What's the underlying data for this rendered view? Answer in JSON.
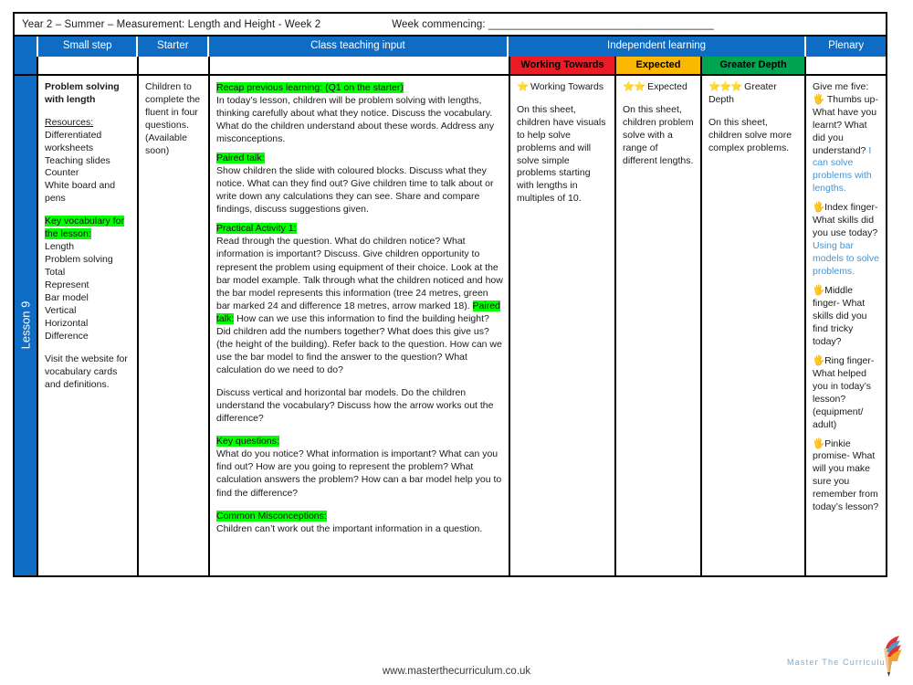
{
  "document": {
    "title_main": "Year 2 – Summer – Measurement: Length and Height  - Week 2",
    "title_week_commencing": "Week commencing: ______________________________________",
    "lesson_spine": "Lesson 9"
  },
  "header": {
    "groups": [
      {
        "label": "Small step"
      },
      {
        "label": "Starter"
      },
      {
        "label": "Class teaching input"
      },
      {
        "label": "Independent learning"
      },
      {
        "label": "Plenary"
      }
    ],
    "independent_sub": [
      {
        "label": "Working Towards",
        "color": "#ec1c24"
      },
      {
        "label": "Expected",
        "color": "#fbb800"
      },
      {
        "label": "Greater Depth",
        "color": "#00a551"
      }
    ]
  },
  "small_step": {
    "heading": "Problem solving with length",
    "resources_label": "Resources:",
    "resources": [
      "Differentiated worksheets",
      "Teaching slides",
      "Counter",
      "White board and pens"
    ],
    "vocab_label": "Key vocabulary for the lesson:",
    "vocab": [
      "Length",
      "Problem solving",
      "Total",
      "Represent",
      "Bar model",
      "Vertical",
      "Horizontal",
      "Difference"
    ],
    "footnote": "Visit the website for vocabulary cards and definitions."
  },
  "starter": {
    "text": "Children to complete the fluent in four questions. (Available soon)"
  },
  "class_teaching_input": {
    "recap_label": "Recap previous learning: (Q1 on the starter)",
    "recap_text": "In today’s lesson, children will be problem solving with lengths, thinking carefully about what they notice. Discuss the vocabulary. What do the children understand about these words. Address any misconceptions.",
    "paired_talk_label": "Paired talk:",
    "paired_talk_text": "Show children the slide with coloured blocks. Discuss what they notice. What can they find out? Give children time to talk about or write down any calculations they can see. Share and compare findings, discuss suggestions given.",
    "practical_label": "Practical Activity 1:",
    "practical_text_part1": "Read through the question. What do children notice? What information is important? Discuss. Give children opportunity to represent the problem using equipment of their choice. Look at the bar model example. Talk through what the children noticed and how the bar model represents this information (tree 24 metres, green bar marked 24 and difference 18 metres, arrow marked 18). ",
    "practical_inline_label": "Paired talk:",
    "practical_text_part2": " How can we use this information to find the building height? Did children add the numbers together? What does this give us? (the height of the building). Refer back to the question. How can we use the bar model to find the answer to the question? What calculation do we need to do?",
    "discuss_text": "Discuss vertical and horizontal bar models. Do the children understand the vocabulary? Discuss how the arrow works out the difference?",
    "key_questions_label": "Key questions:",
    "key_questions_text": "What do you notice? What information is important? What can you find out? How are you going to represent the problem? What calculation answers the problem? How can a bar model help you to find the difference?",
    "misconceptions_label": "Common Misconceptions:",
    "misconceptions_text": "Children can’t work out the important information in a question."
  },
  "independent_learning": {
    "working_towards": {
      "stars": "⭐",
      "star_label": "Working Towards",
      "text": "On this sheet, children have visuals to help solve problems and will solve simple problems starting with lengths in multiples of 10."
    },
    "expected": {
      "stars": "⭐⭐",
      "star_label": "Expected",
      "text": "On this sheet, children problem solve with a range of different lengths."
    },
    "greater_depth": {
      "stars": "⭐⭐⭐",
      "star_label": "Greater Depth",
      "text": "On this sheet, children solve more complex problems."
    }
  },
  "plenary": {
    "intro": "Give me five:",
    "items": [
      {
        "icon": "🖐",
        "question": "Thumbs up- What have you learnt? What did you understand?",
        "answer": "I can solve problems with lengths."
      },
      {
        "icon": "🖐",
        "question": "Index finger- What skills did you use today?",
        "answer": "Using bar models to solve problems."
      },
      {
        "icon": "🖐",
        "question": "Middle finger- What skills did you find tricky today?",
        "answer": ""
      },
      {
        "icon": "🖐",
        "question": "Ring finger- What helped you in today’s lesson? (equipment/ adult)",
        "answer": ""
      },
      {
        "icon": "🖐",
        "question": "Pinkie promise- What will you make sure you remember from today’s lesson?",
        "answer": ""
      }
    ]
  },
  "footer": {
    "url": "www.masterthecurriculum.co.uk",
    "logo_text": "Master  The  Curriculum"
  },
  "colors": {
    "brand_blue": "#0f6cc4",
    "highlight_green": "#00ff00",
    "working_towards": "#ec1c24",
    "expected": "#fbb800",
    "greater_depth": "#00a551",
    "plenary_answer_blue": "#4494d6"
  }
}
